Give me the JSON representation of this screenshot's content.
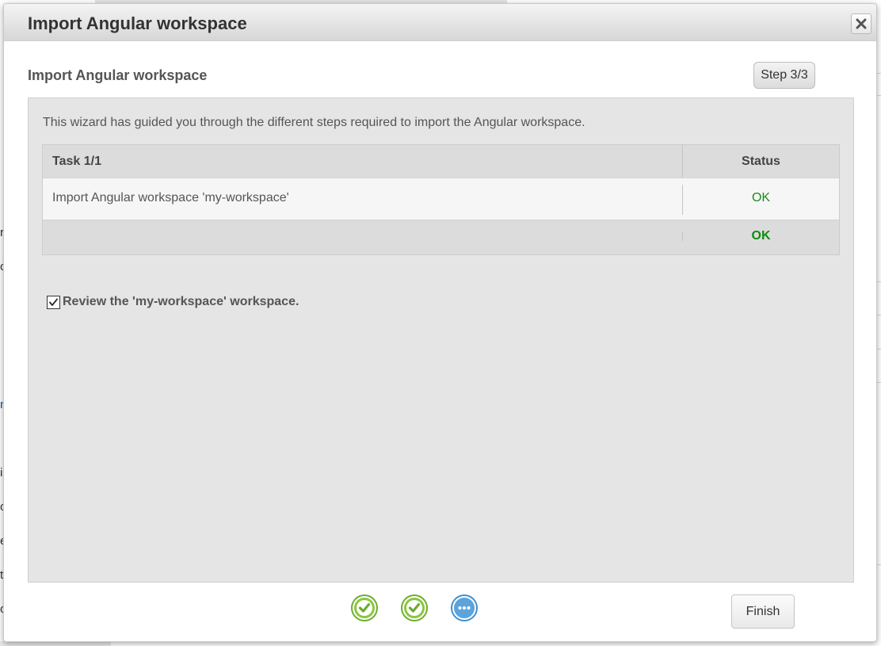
{
  "dialog": {
    "title": "Import Angular workspace",
    "close_icon": "close-icon"
  },
  "wizard": {
    "section_header": "Import Angular workspace",
    "step_label": "Step 3/3",
    "intro": "This wizard has guided you through the different steps required to import the Angular workspace.",
    "table": {
      "header_task": "Task 1/1",
      "header_status": "Status",
      "rows": [
        {
          "task": "Import Angular workspace 'my-workspace'",
          "status": "OK"
        }
      ],
      "overall_status": "OK"
    },
    "review": {
      "checked": true,
      "label": "Review the 'my-workspace' workspace."
    },
    "steps": [
      {
        "state": "complete",
        "icon": "check-circle-icon",
        "color": "#7bb93a"
      },
      {
        "state": "complete",
        "icon": "check-circle-icon",
        "color": "#7bb93a"
      },
      {
        "state": "current",
        "icon": "ellipsis-circle-icon",
        "color": "#5aa3dc"
      }
    ],
    "finish_label": "Finish"
  },
  "colors": {
    "ok_green": "#1e8a1e",
    "panel_bg": "#e5e5e5"
  }
}
